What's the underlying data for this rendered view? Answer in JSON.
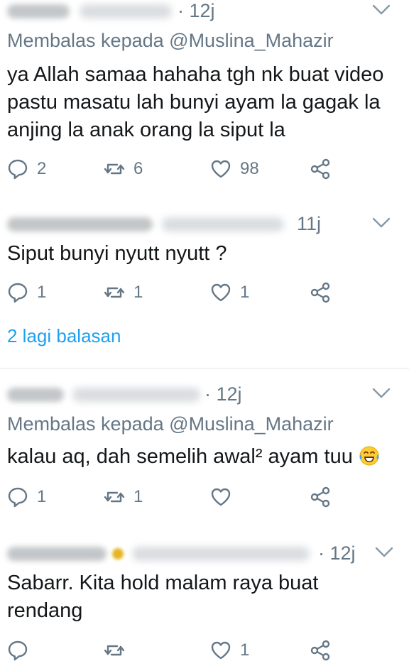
{
  "colors": {
    "accent": "#1da1f2",
    "muted": "#657786",
    "text": "#14171a",
    "divider": "#e1e8ed"
  },
  "tweets": [
    {
      "time": "· 12j",
      "reply_prefix": "Membalas kepada",
      "reply_handle": "@Muslina_Mahazir",
      "lines": [
        "ya Allah samaa hahaha tgh nk buat video",
        "pastu masatu lah bunyi ayam la gagak la",
        "anjing la anak orang la siput la"
      ],
      "replies": "2",
      "retweets": "6",
      "likes": "98"
    },
    {
      "time": "11j",
      "lines": [
        "Siput bunyi nyutt nyutt ?"
      ],
      "replies": "1",
      "retweets": "1",
      "likes": "1",
      "more_replies": "2 lagi balasan"
    },
    {
      "time": "· 12j",
      "reply_prefix": "Membalas kepada",
      "reply_handle": "@Muslina_Mahazir",
      "lines": [
        "kalau aq, dah semelih awal² ayam tuu"
      ],
      "emoji": "tears-of-joy-emoji",
      "replies": "1",
      "retweets": "1",
      "likes": ""
    },
    {
      "time": "· 12j",
      "lines": [
        "Sabarr. Kita hold malam raya buat",
        "rendang"
      ],
      "replies": "",
      "retweets": "",
      "likes": "1"
    }
  ]
}
